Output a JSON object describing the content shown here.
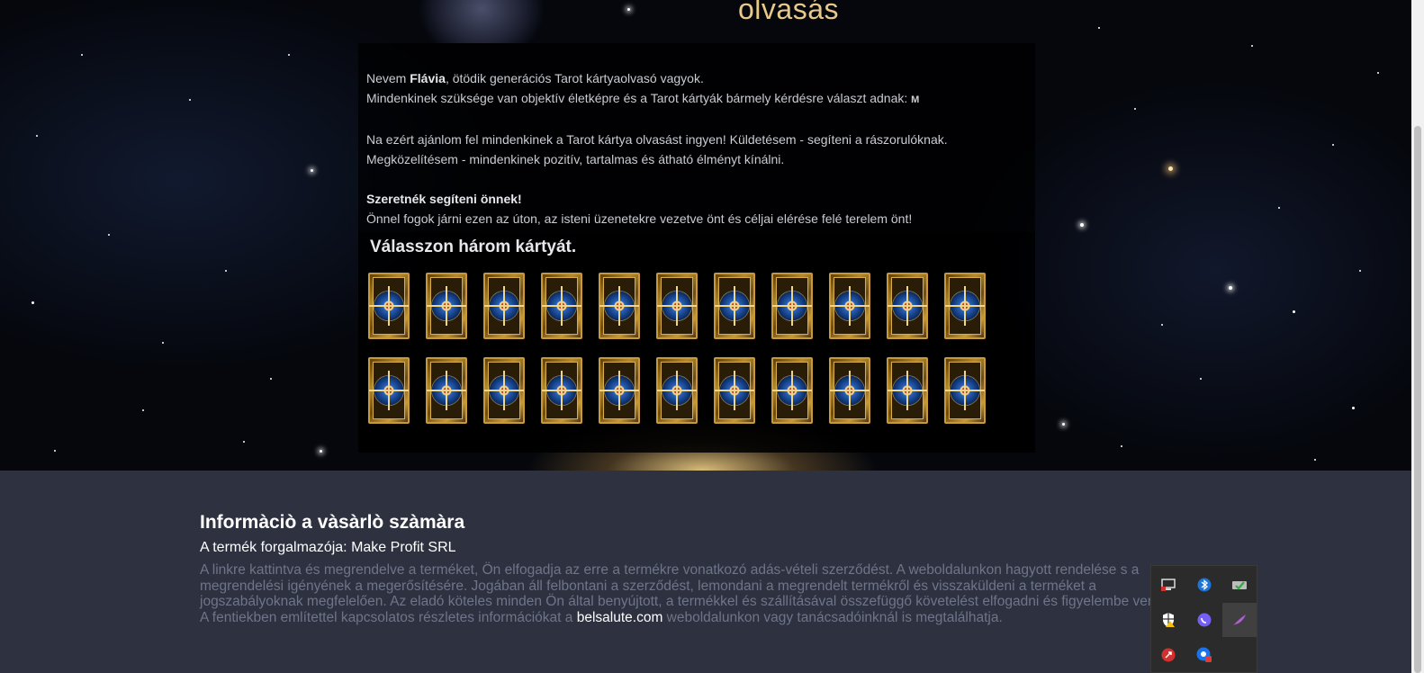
{
  "hero": {
    "title": "olvasás"
  },
  "intro": {
    "line1_pre": "Nevem ",
    "line1_name": "Flávia",
    "line1_post": ", ötödik generációs Tarot kártyaolvasó vagyok.",
    "line2": "Mindenkinek szüksége van objektív életképre és a Tarot kártyák bármely kérdésre választ adnak: ",
    "line2_mark": "M",
    "line3": "Na ezért ajánlom fel mindenkinek a Tarot kártya olvasást ingyen! Küldetésem - segíteni a rászorulóknak.",
    "line4": "Megközelítésem - mindenkinek pozitív, tartalmas és átható élményt kínálni.",
    "line5_bold": "Szeretnék segíteni önnek!",
    "line6": "Önnel fogok járni ezen az úton, az isteni üzenetekre vezetve önt és céljai elérése felé terelem önt!"
  },
  "cards": {
    "title": "Válasszon három kártyát.",
    "rows": 2,
    "per_row": 11
  },
  "footer": {
    "title": "Informàciò a vàsàrlò szàmàra",
    "distributor": "A termék forgalmazója: Make Profit SRL",
    "text_pre": "A linkre kattintva és megrendelve a terméket, Ön elfogadja az erre a termékre vonatkozó adás-vételi szerződést. A weboldalunkon hagyott rendelése s a megrendelési igényének a megerősítésére. Jogában áll felbontani a szerződést, lemondani a megrendelt termékről és visszaküldeni a terméket a jogszabályoknak megfelelően. Az eladó köteles minden Ön által benyújtott, a termékkel és szállításával összefüggő követelést elfogadni és figyelembe venni. A fentiekben említettel kapcsolatos részletes információkat a ",
    "link": "belsalute.com",
    "text_post": " weboldalunkon vagy tanácsadóinknál is megtalálhatja."
  },
  "tray": {
    "icons": [
      "network-icon",
      "bluetooth-icon",
      "security-check-icon",
      "windows-security-icon",
      "viber-icon",
      "feather-icon",
      "antivirus-icon",
      "chrome-update-icon"
    ]
  },
  "colors": {
    "hero_title": "#e8c98a",
    "footer_bg": "#2d3140",
    "footer_text": "#6f7588"
  }
}
